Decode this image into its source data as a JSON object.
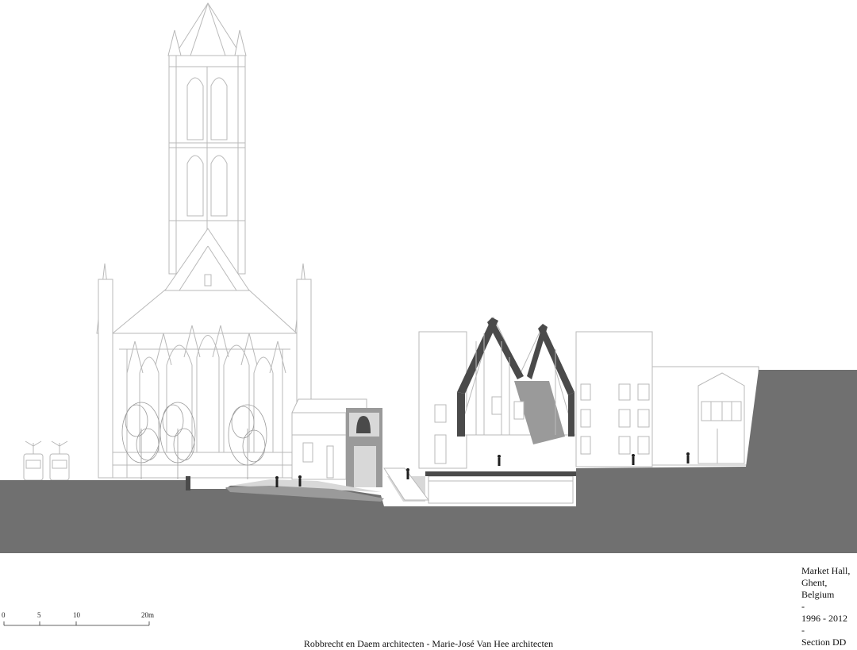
{
  "scale_bar": {
    "ticks": [
      "0",
      "5",
      "10",
      "20m"
    ]
  },
  "title_block": {
    "lines": [
      "Market Hall,",
      "Ghent,",
      "Belgium",
      "-",
      "1996 - 2012",
      "-",
      "Section DD"
    ]
  },
  "credit": "Robbrecht en Daem architecten - Marie-José Van Hee architecten"
}
